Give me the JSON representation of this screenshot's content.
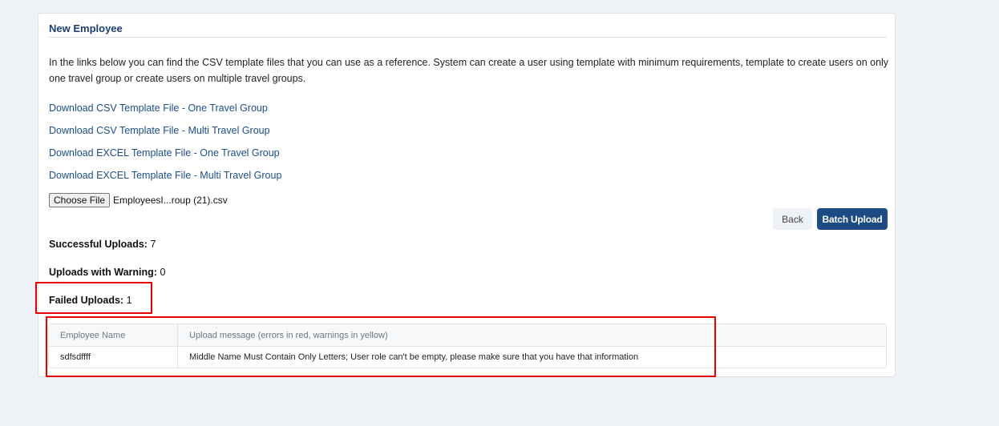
{
  "card": {
    "title": "New Employee",
    "description": "In the links below you can find the CSV template files that you can use as a reference. System can create a user using template with minimum requirements, template to create users on only one travel group or create users on multiple travel groups."
  },
  "downloads": [
    {
      "label": "Download CSV Template File - One Travel Group"
    },
    {
      "label": "Download CSV Template File - Multi Travel Group"
    },
    {
      "label": "Download EXCEL Template File - One Travel Group"
    },
    {
      "label": "Download EXCEL Template File - Multi Travel Group"
    }
  ],
  "file_input": {
    "button_label": "Choose File",
    "file_name": "EmployeesI...roup (21).csv"
  },
  "actions": {
    "back_label": "Back",
    "batch_upload_label": "Batch Upload"
  },
  "stats": {
    "successful_label": "Successful Uploads:",
    "successful_value": "7",
    "warning_label": "Uploads with Warning:",
    "warning_value": "0",
    "failed_label": "Failed Uploads:",
    "failed_value": "1"
  },
  "results_table": {
    "headers": [
      "Employee Name",
      "Upload message (errors in red, warnings in yellow)"
    ],
    "rows": [
      {
        "name": "sdfsdffff",
        "message": "Middle Name Must Contain Only Letters; User role can't be empty, please make sure that you have that information"
      }
    ]
  },
  "colors": {
    "accent": "#1c4a82",
    "link": "#1c4e8a",
    "highlight": "#e60000",
    "background": "#eef1f5"
  }
}
